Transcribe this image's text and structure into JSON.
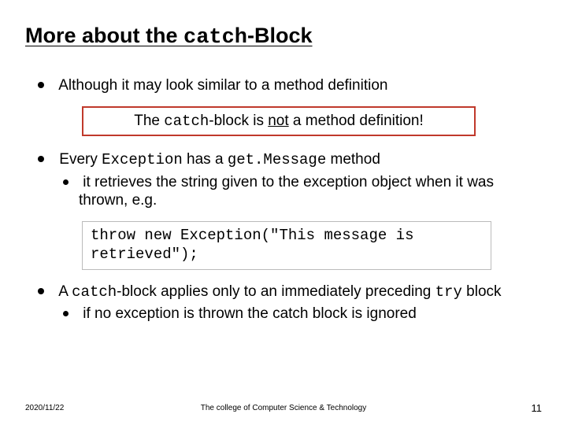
{
  "title_pre": "More about the ",
  "title_code": "catch",
  "title_post": "-Block",
  "bullet1": "Although it may look similar to a method definition",
  "callout_pre": "The ",
  "callout_code": "catch",
  "callout_mid": "-block is ",
  "callout_und": "not",
  "callout_post": " a method definition!",
  "bullet2_pre": "Every ",
  "bullet2_code1": "Exception",
  "bullet2_mid": " has a ",
  "bullet2_code2": "get.Message",
  "bullet2_post": " method",
  "bullet2_sub": "it retrieves the string given to the exception object when it was thrown, e.g.",
  "code_line": "throw new Exception(\"This message is retrieved\");",
  "bullet3_pre": "A ",
  "bullet3_code": "catch",
  "bullet3_mid": "-block applies only to an immediately preceding ",
  "bullet3_code2": "try",
  "bullet3_post": " block",
  "bullet3_sub": "if no exception is thrown the catch block is ignored",
  "footer_date": "2020/11/22",
  "footer_center": "The college of Computer Science & Technology",
  "footer_page": "11"
}
